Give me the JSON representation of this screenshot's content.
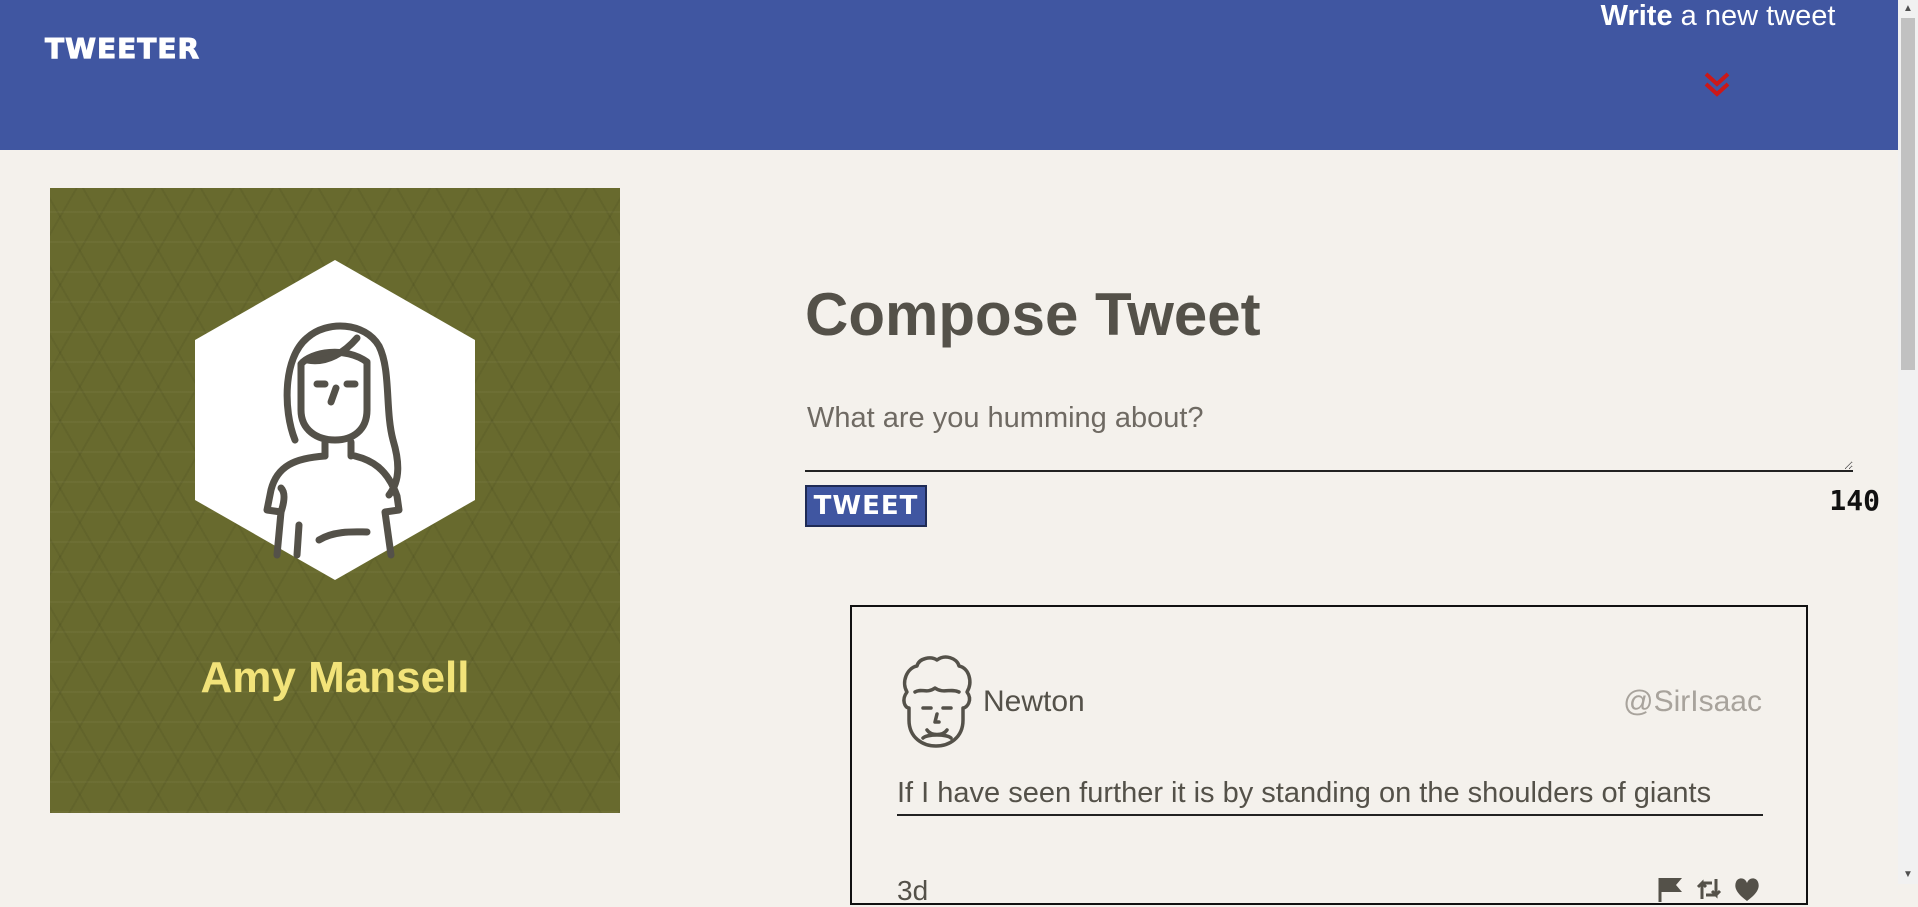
{
  "nav": {
    "brand": "TWEETER",
    "write_strong": "Write",
    "write_rest": "a new tweet",
    "accent_color": "#cc1818",
    "nav_color": "#4056a1"
  },
  "profile": {
    "name": "Amy Mansell",
    "background_color": "#686a2e",
    "name_color": "#f2e379"
  },
  "compose": {
    "title": "Compose Tweet",
    "placeholder": "What are you humming about?",
    "tweet_button_label": "TWEET",
    "counter": "140"
  },
  "tweets": [
    {
      "name": "Newton",
      "handle": "@SirIsaac",
      "content": "If I have seen further it is by standing on the shoulders of giants",
      "time": "3d",
      "actions": [
        "flag-icon",
        "retweet-icon",
        "heart-icon"
      ]
    }
  ]
}
